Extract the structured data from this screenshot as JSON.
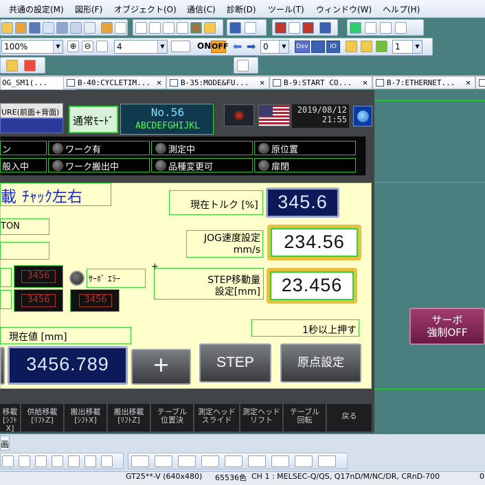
{
  "menu": [
    "共通の設定(M)",
    "図形(F)",
    "オブジェクト(O)",
    "通信(C)",
    "診断(D)",
    "ツール(T)",
    "ウィンドウ(W)",
    "ヘルプ(H)"
  ],
  "toolbar": {
    "zoom_value": "100%",
    "grid_value": "4",
    "on_label": "ON",
    "off_label": "OFF",
    "layer_value": "0",
    "dev_label": "Dev",
    "io_label": "IO",
    "page_value": "1"
  },
  "tabs": [
    {
      "label": "OG_SM1(..."
    },
    {
      "label": "B-40:CYCLETIM..."
    },
    {
      "label": "B-35:MODE&FU..."
    },
    {
      "label": "B-9:START CO..."
    },
    {
      "label": "B-7:ETHERNET..."
    }
  ],
  "header": {
    "left_label": "URE(前面+背面)",
    "mode_label": "通常ﾓｰﾄﾞ",
    "no_label": "No.56",
    "code_label": "ABCDEFGHIJKL",
    "date": "2019/08/12",
    "time": "21:55"
  },
  "lamps": {
    "row1": [
      "ン",
      "ワーク有",
      "測定中",
      "原位置"
    ],
    "row2": [
      "般入中",
      "ワーク搬出中",
      "品種変更可",
      "扉閉"
    ]
  },
  "panel": {
    "title": "載",
    "chuck_label": "ﾁｬｯｸ左右",
    "on_text": "TON",
    "torque_label": "現在トルク [%]",
    "torque_value": "345.6",
    "jog_label_1": "JOG速度設定",
    "jog_label_2": "mm/s",
    "jog_value": "234.56",
    "servo_err_label": "ｻｰﾎﾞ ｴﾗｰ",
    "red1": "3456",
    "red2": "3456",
    "red3": "3456",
    "plus_marker": "+",
    "step_label_1": "STEP移動量",
    "step_label_2": "設定[mm]",
    "step_value": "23.456",
    "hold_label": "1秒以上押す",
    "current_label": "現在値 [mm]",
    "current_value": "3456.789",
    "plus_button": "+",
    "step_button": "STEP",
    "origin_button": "原点設定"
  },
  "servo_button": {
    "line1": "サーボ",
    "line2": "強制OFF"
  },
  "fkeys": [
    {
      "l1": "移載",
      "l2": "[ｼﾌﾄX]"
    },
    {
      "l1": "供給移載",
      "l2": "[ﾘﾌﾄZ]"
    },
    {
      "l1": "搬出移載",
      "l2": "[ｼﾌﾄX]"
    },
    {
      "l1": "搬出移載",
      "l2": "[ﾘﾌﾄZ]"
    },
    {
      "l1": "テーブル",
      "l2": "位置決"
    },
    {
      "l1": "測定ヘッド",
      "l2": "スライド"
    },
    {
      "l1": "測定ヘッド",
      "l2": "リフト"
    },
    {
      "l1": "テーブル",
      "l2": "回転"
    },
    {
      "l1": "戻る",
      "l2": ""
    }
  ],
  "bottom_tab": "画",
  "status": {
    "model": "GT25**-V (640x480)",
    "colors": "65536色",
    "channel": "CH 1 : MELSEC-Q/QS, Q17nD/M/NC/DR, CRnD-700",
    "extra": "0"
  },
  "colors": {
    "accent": "#29c229",
    "panel_bg": "#ffffcc",
    "screen_bg": "#424548",
    "workspace": "#4a7f7f"
  }
}
